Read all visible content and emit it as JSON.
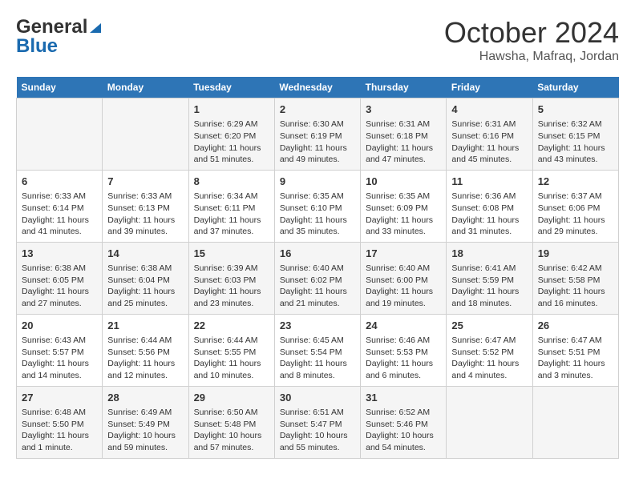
{
  "header": {
    "logo_general": "General",
    "logo_blue": "Blue",
    "month": "October 2024",
    "location": "Hawsha, Mafraq, Jordan"
  },
  "days_of_week": [
    "Sunday",
    "Monday",
    "Tuesday",
    "Wednesday",
    "Thursday",
    "Friday",
    "Saturday"
  ],
  "weeks": [
    [
      {
        "day": "",
        "content": ""
      },
      {
        "day": "",
        "content": ""
      },
      {
        "day": "1",
        "content": "Sunrise: 6:29 AM\nSunset: 6:20 PM\nDaylight: 11 hours and 51 minutes."
      },
      {
        "day": "2",
        "content": "Sunrise: 6:30 AM\nSunset: 6:19 PM\nDaylight: 11 hours and 49 minutes."
      },
      {
        "day": "3",
        "content": "Sunrise: 6:31 AM\nSunset: 6:18 PM\nDaylight: 11 hours and 47 minutes."
      },
      {
        "day": "4",
        "content": "Sunrise: 6:31 AM\nSunset: 6:16 PM\nDaylight: 11 hours and 45 minutes."
      },
      {
        "day": "5",
        "content": "Sunrise: 6:32 AM\nSunset: 6:15 PM\nDaylight: 11 hours and 43 minutes."
      }
    ],
    [
      {
        "day": "6",
        "content": "Sunrise: 6:33 AM\nSunset: 6:14 PM\nDaylight: 11 hours and 41 minutes."
      },
      {
        "day": "7",
        "content": "Sunrise: 6:33 AM\nSunset: 6:13 PM\nDaylight: 11 hours and 39 minutes."
      },
      {
        "day": "8",
        "content": "Sunrise: 6:34 AM\nSunset: 6:11 PM\nDaylight: 11 hours and 37 minutes."
      },
      {
        "day": "9",
        "content": "Sunrise: 6:35 AM\nSunset: 6:10 PM\nDaylight: 11 hours and 35 minutes."
      },
      {
        "day": "10",
        "content": "Sunrise: 6:35 AM\nSunset: 6:09 PM\nDaylight: 11 hours and 33 minutes."
      },
      {
        "day": "11",
        "content": "Sunrise: 6:36 AM\nSunset: 6:08 PM\nDaylight: 11 hours and 31 minutes."
      },
      {
        "day": "12",
        "content": "Sunrise: 6:37 AM\nSunset: 6:06 PM\nDaylight: 11 hours and 29 minutes."
      }
    ],
    [
      {
        "day": "13",
        "content": "Sunrise: 6:38 AM\nSunset: 6:05 PM\nDaylight: 11 hours and 27 minutes."
      },
      {
        "day": "14",
        "content": "Sunrise: 6:38 AM\nSunset: 6:04 PM\nDaylight: 11 hours and 25 minutes."
      },
      {
        "day": "15",
        "content": "Sunrise: 6:39 AM\nSunset: 6:03 PM\nDaylight: 11 hours and 23 minutes."
      },
      {
        "day": "16",
        "content": "Sunrise: 6:40 AM\nSunset: 6:02 PM\nDaylight: 11 hours and 21 minutes."
      },
      {
        "day": "17",
        "content": "Sunrise: 6:40 AM\nSunset: 6:00 PM\nDaylight: 11 hours and 19 minutes."
      },
      {
        "day": "18",
        "content": "Sunrise: 6:41 AM\nSunset: 5:59 PM\nDaylight: 11 hours and 18 minutes."
      },
      {
        "day": "19",
        "content": "Sunrise: 6:42 AM\nSunset: 5:58 PM\nDaylight: 11 hours and 16 minutes."
      }
    ],
    [
      {
        "day": "20",
        "content": "Sunrise: 6:43 AM\nSunset: 5:57 PM\nDaylight: 11 hours and 14 minutes."
      },
      {
        "day": "21",
        "content": "Sunrise: 6:44 AM\nSunset: 5:56 PM\nDaylight: 11 hours and 12 minutes."
      },
      {
        "day": "22",
        "content": "Sunrise: 6:44 AM\nSunset: 5:55 PM\nDaylight: 11 hours and 10 minutes."
      },
      {
        "day": "23",
        "content": "Sunrise: 6:45 AM\nSunset: 5:54 PM\nDaylight: 11 hours and 8 minutes."
      },
      {
        "day": "24",
        "content": "Sunrise: 6:46 AM\nSunset: 5:53 PM\nDaylight: 11 hours and 6 minutes."
      },
      {
        "day": "25",
        "content": "Sunrise: 6:47 AM\nSunset: 5:52 PM\nDaylight: 11 hours and 4 minutes."
      },
      {
        "day": "26",
        "content": "Sunrise: 6:47 AM\nSunset: 5:51 PM\nDaylight: 11 hours and 3 minutes."
      }
    ],
    [
      {
        "day": "27",
        "content": "Sunrise: 6:48 AM\nSunset: 5:50 PM\nDaylight: 11 hours and 1 minute."
      },
      {
        "day": "28",
        "content": "Sunrise: 6:49 AM\nSunset: 5:49 PM\nDaylight: 10 hours and 59 minutes."
      },
      {
        "day": "29",
        "content": "Sunrise: 6:50 AM\nSunset: 5:48 PM\nDaylight: 10 hours and 57 minutes."
      },
      {
        "day": "30",
        "content": "Sunrise: 6:51 AM\nSunset: 5:47 PM\nDaylight: 10 hours and 55 minutes."
      },
      {
        "day": "31",
        "content": "Sunrise: 6:52 AM\nSunset: 5:46 PM\nDaylight: 10 hours and 54 minutes."
      },
      {
        "day": "",
        "content": ""
      },
      {
        "day": "",
        "content": ""
      }
    ]
  ]
}
